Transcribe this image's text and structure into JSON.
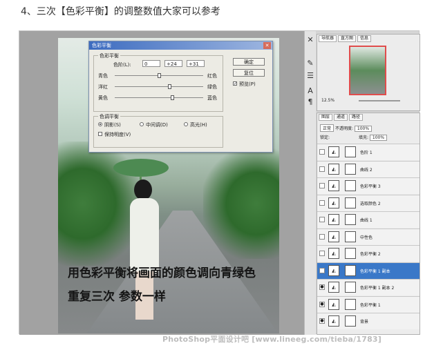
{
  "heading": "4、三次【色彩平衡】的调整数值大家可以参考",
  "overlay": {
    "line1": "用色彩平衡将画面的颜色调向青绿色",
    "line2": "重复三次 参数一样"
  },
  "dialog": {
    "title": "色彩平衡",
    "group_balance": "色彩平衡",
    "levels_label": "色阶(L):",
    "levels": [
      "0",
      "+24",
      "+31"
    ],
    "sliders": [
      {
        "left": "青色",
        "right": "红色",
        "value": 0
      },
      {
        "left": "洋红",
        "right": "绿色",
        "value": 24
      },
      {
        "left": "黄色",
        "right": "蓝色",
        "value": 31
      }
    ],
    "group_tone": "色调平衡",
    "tones": [
      "阴影(S)",
      "中间调(D)",
      "高光(H)"
    ],
    "selected_tone": 0,
    "preserve_lum": "保持明度(V)",
    "ok": "确定",
    "reset": "复位",
    "preview": "预览(P)"
  },
  "navigator": {
    "tabs": [
      "导航器",
      "直方图",
      "信息"
    ],
    "zoom": "12.5%"
  },
  "layers_panel": {
    "tabs": [
      "图层",
      "通道",
      "路径"
    ],
    "blend": "正常",
    "opacity_label": "不透明度:",
    "opacity": "100%",
    "lock_label": "锁定:",
    "fill_label": "填充:",
    "fill": "100%",
    "layers": [
      {
        "name": "色阶 1",
        "visible": false,
        "selected": false
      },
      {
        "name": "曲线 2",
        "visible": false,
        "selected": false
      },
      {
        "name": "色彩平衡 3",
        "visible": false,
        "selected": false
      },
      {
        "name": "选取颜色 2",
        "visible": false,
        "selected": false
      },
      {
        "name": "曲线 1",
        "visible": false,
        "selected": false
      },
      {
        "name": "中性色",
        "visible": false,
        "selected": false
      },
      {
        "name": "色彩平衡 2",
        "visible": false,
        "selected": false
      },
      {
        "name": "色彩平衡 1 副本",
        "visible": true,
        "selected": true
      },
      {
        "name": "色彩平衡 1 副本 2",
        "visible": true,
        "selected": false
      },
      {
        "name": "色彩平衡 1",
        "visible": true,
        "selected": false
      },
      {
        "name": "背景",
        "visible": true,
        "selected": false
      }
    ]
  },
  "watermark": "PhotoShop平面设计吧 [www.lineeg.com/tieba/1783]"
}
